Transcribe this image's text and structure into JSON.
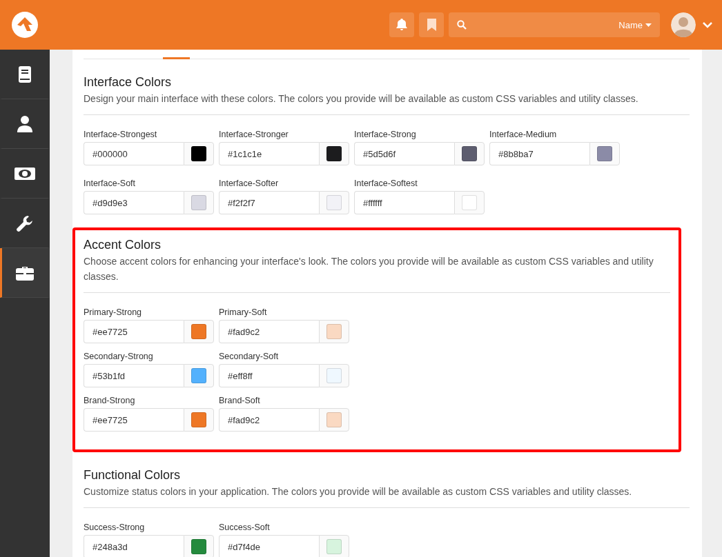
{
  "header": {
    "search": {
      "filter_label": "Name"
    }
  },
  "sidebar": {
    "items": [
      {
        "selected": false
      },
      {
        "selected": false
      },
      {
        "selected": false
      },
      {
        "selected": false
      },
      {
        "selected": true
      }
    ]
  },
  "sections": [
    {
      "title": "Interface Colors",
      "description": "Design your main interface with these colors. The colors you provide will be available as custom CSS variables and utility classes.",
      "highlighted": false,
      "rows": [
        [
          {
            "label": "Interface-Strongest",
            "value": "#000000",
            "color": "#000000"
          },
          {
            "label": "Interface-Stronger",
            "value": "#1c1c1e",
            "color": "#1c1c1e"
          },
          {
            "label": "Interface-Strong",
            "value": "#5d5d6f",
            "color": "#5d5d6f"
          },
          {
            "label": "Interface-Medium",
            "value": "#8b8ba7",
            "color": "#8b8ba7"
          }
        ],
        [
          {
            "label": "Interface-Soft",
            "value": "#d9d9e3",
            "color": "#d9d9e3"
          },
          {
            "label": "Interface-Softer",
            "value": "#f2f2f7",
            "color": "#f2f2f7"
          },
          {
            "label": "Interface-Softest",
            "value": "#ffffff",
            "color": "#ffffff"
          }
        ]
      ]
    },
    {
      "title": "Accent Colors",
      "description": "Choose accent colors for enhancing your interface's look. The colors you provide will be available as custom CSS variables and utility classes.",
      "highlighted": true,
      "rows": [
        [
          {
            "label": "Primary-Strong",
            "value": "#ee7725",
            "color": "#ee7725"
          },
          {
            "label": "Primary-Soft",
            "value": "#fad9c2",
            "color": "#fad9c2"
          }
        ],
        [
          {
            "label": "Secondary-Strong",
            "value": "#53b1fd",
            "color": "#53b1fd"
          },
          {
            "label": "Secondary-Soft",
            "value": "#eff8ff",
            "color": "#eff8ff"
          }
        ],
        [
          {
            "label": "Brand-Strong",
            "value": "#ee7725",
            "color": "#ee7725"
          },
          {
            "label": "Brand-Soft",
            "value": "#fad9c2",
            "color": "#fad9c2"
          }
        ]
      ]
    },
    {
      "title": "Functional Colors",
      "description": "Customize status colors in your application. The colors you provide will be available as custom CSS variables and utility classes.",
      "highlighted": false,
      "rows": [
        [
          {
            "label": "Success-Strong",
            "value": "#248a3d",
            "color": "#248a3d"
          },
          {
            "label": "Success-Soft",
            "value": "#d7f4de",
            "color": "#d7f4de"
          }
        ]
      ]
    }
  ]
}
